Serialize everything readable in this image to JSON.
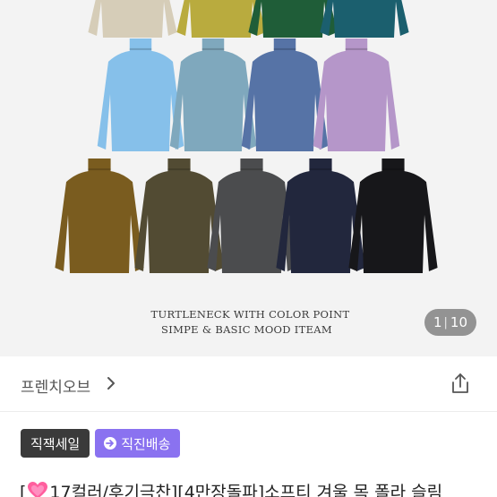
{
  "product_image": {
    "caption_line1": "TURTLENECK WITH COLOR POINT",
    "caption_line2": "SIMPE & BASIC MOOD ITEAM",
    "counter_current": "1",
    "counter_total": "10",
    "shirt_colors_row1": [
      "#d6cdb8",
      "#b9ab3e",
      "#1f5d38",
      "#1b5f6e"
    ],
    "shirt_colors_row2": [
      "#86c0ea",
      "#7fa8bd",
      "#5673a6",
      "#b596c9"
    ],
    "shirt_colors_row3": [
      "#7a5c1f",
      "#524b33",
      "#4b4c4e",
      "#22273d",
      "#17171a"
    ],
    "background": "#f3f3f3"
  },
  "shop": {
    "name": "프렌치오브",
    "chevron_icon": "chevron-right-icon",
    "share_icon": "share-icon"
  },
  "badges": {
    "direct_sale": "직잭세일",
    "direct_delivery": "직진배송",
    "delivery_icon": "arrow-circle-icon",
    "colors": {
      "dark": "#3a3a3a",
      "purple": "#8a72f0"
    }
  },
  "product": {
    "title_open": "[",
    "title_heart_icon": "heart-icon",
    "title_text": "17컬러/후기극찬][4만장돌파]소프티 겨울 목 폴라 슬림"
  }
}
